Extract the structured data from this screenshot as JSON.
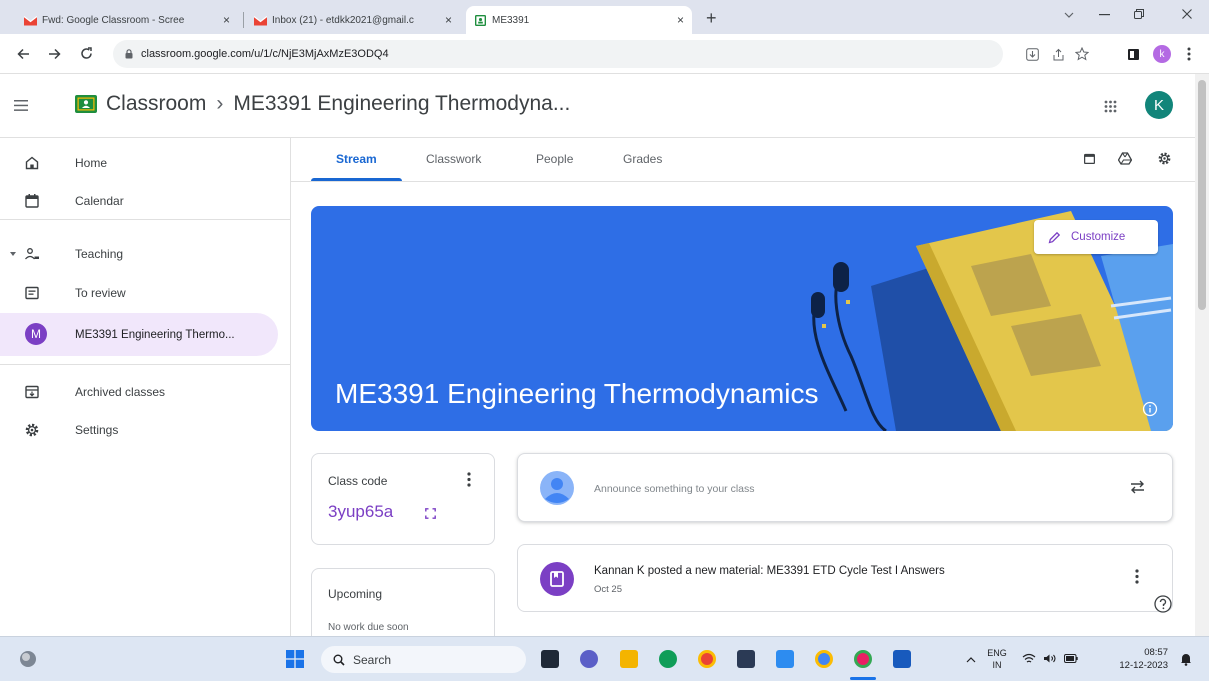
{
  "browser": {
    "tabs": [
      {
        "title": "Fwd: Google Classroom - Scree"
      },
      {
        "title": "Inbox (21) - etdkk2021@gmail.c"
      },
      {
        "title": "ME3391"
      }
    ],
    "close_glyph": "×",
    "new_tab_glyph": "+",
    "url": "classroom.google.com/u/1/c/NjE3MjAxMzE3ODQ4",
    "profile_initial": "k"
  },
  "header": {
    "app_name": "Classroom",
    "separator": "›",
    "class_title": "ME3391 Engineering Thermodyna...",
    "avatar_initial": "K"
  },
  "sidebar": {
    "home": "Home",
    "calendar": "Calendar",
    "teaching": "Teaching",
    "to_review": "To review",
    "class_initial": "M",
    "class_name": "ME3391 Engineering Thermo...",
    "archived": "Archived classes",
    "settings": "Settings"
  },
  "tabs": {
    "stream": "Stream",
    "classwork": "Classwork",
    "people": "People",
    "grades": "Grades"
  },
  "banner": {
    "title": "ME3391 Engineering Thermodynamics",
    "customize": "Customize"
  },
  "class_code": {
    "label": "Class code",
    "code": "3yup65a"
  },
  "upcoming": {
    "label": "Upcoming",
    "empty": "No work due soon"
  },
  "announce": {
    "placeholder": "Announce something to your class"
  },
  "post": {
    "text": "Kannan K posted a new material: ME3391 ETD Cycle Test I Answers",
    "date": "Oct 25"
  },
  "taskbar": {
    "search": "Search",
    "lang_top": "ENG",
    "lang_bottom": "IN",
    "time": "08:57",
    "date": "12-12-2023"
  },
  "colors": {
    "accent": "#1967d2",
    "banner": "#2e6ee6",
    "class_avatar": "#7b3fc4",
    "header_avatar": "#12857a"
  }
}
